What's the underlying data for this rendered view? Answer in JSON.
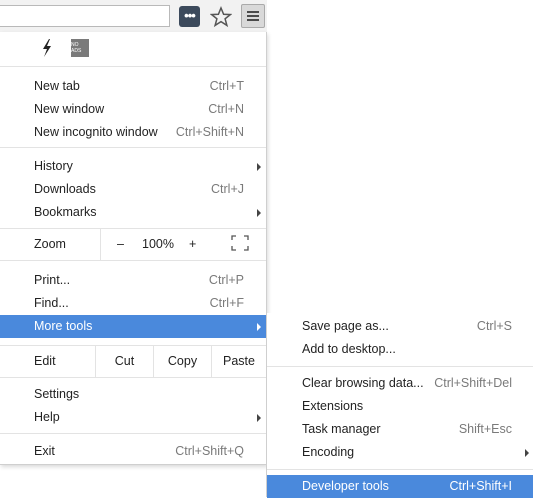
{
  "toolbar": {
    "menu_button": "Chrome menu",
    "star": "Bookmark this page",
    "extension": "Extension"
  },
  "extensions": {
    "noads_label": "NO ADS"
  },
  "menu": {
    "new_tab": {
      "label": "New tab",
      "shortcut": "Ctrl+T"
    },
    "new_window": {
      "label": "New window",
      "shortcut": "Ctrl+N"
    },
    "new_incognito": {
      "label": "New incognito window",
      "shortcut": "Ctrl+Shift+N"
    },
    "history": {
      "label": "History"
    },
    "downloads": {
      "label": "Downloads",
      "shortcut": "Ctrl+J"
    },
    "bookmarks": {
      "label": "Bookmarks"
    },
    "zoom": {
      "label": "Zoom",
      "minus": "–",
      "value": "100%",
      "plus": "+"
    },
    "print": {
      "label": "Print...",
      "shortcut": "Ctrl+P"
    },
    "find": {
      "label": "Find...",
      "shortcut": "Ctrl+F"
    },
    "more_tools": {
      "label": "More tools"
    },
    "edit": {
      "label": "Edit",
      "cut": "Cut",
      "copy": "Copy",
      "paste": "Paste"
    },
    "settings": {
      "label": "Settings"
    },
    "help": {
      "label": "Help"
    },
    "exit": {
      "label": "Exit",
      "shortcut": "Ctrl+Shift+Q"
    }
  },
  "submenu": {
    "save_page": {
      "label": "Save page as...",
      "shortcut": "Ctrl+S"
    },
    "add_desktop": {
      "label": "Add to desktop..."
    },
    "clear_data": {
      "label": "Clear browsing data...",
      "shortcut": "Ctrl+Shift+Del"
    },
    "extensions": {
      "label": "Extensions"
    },
    "task_manager": {
      "label": "Task manager",
      "shortcut": "Shift+Esc"
    },
    "encoding": {
      "label": "Encoding"
    },
    "dev_tools": {
      "label": "Developer tools",
      "shortcut": "Ctrl+Shift+I"
    }
  },
  "colors": {
    "highlight": "#4a89dc",
    "shortcut_text": "#7a7a7a"
  }
}
